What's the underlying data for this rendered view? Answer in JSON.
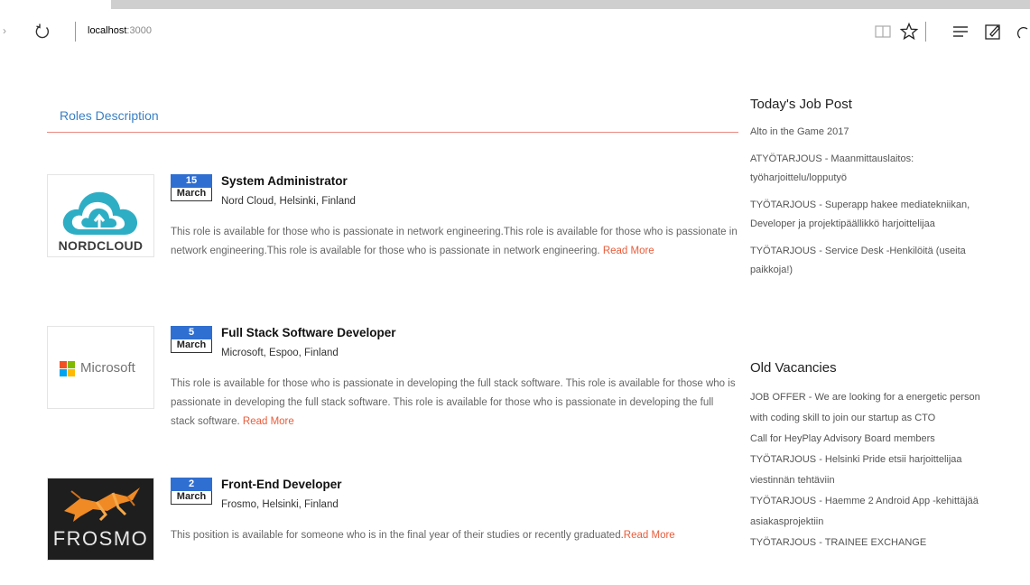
{
  "browser": {
    "url_host": "localhost",
    "url_port": ":3000"
  },
  "main": {
    "section_title": "Roles Description",
    "jobs": [
      {
        "day": "15",
        "month": "March",
        "title": "System Administrator",
        "company": "Nord Cloud, Helsinki, Finland",
        "description": "This role is available for those who is passionate in network engineering.This role is available for those who is passionate in network engineering.This role is available for those who is passionate in network engineering. ",
        "read_more": "Read More",
        "logo_text": "NORDCLOUD"
      },
      {
        "day": "5",
        "month": "March",
        "title": "Full Stack Software Developer",
        "company": "Microsoft, Espoo, Finland",
        "description": "This role is available for those who is passionate in developing the full stack software. This role is available for those who is passionate in developing the full stack software. This role is available for those who is passionate in developing the full stack software. ",
        "read_more": "Read More",
        "logo_text": "Microsoft"
      },
      {
        "day": "2",
        "month": "March",
        "title": "Front-End Developer",
        "company": "Frosmo, Helsinki, Finland",
        "description": "This position is available for someone who is in the final year of their studies or recently graduated.",
        "read_more": "Read More",
        "logo_text": "FROSMO"
      }
    ]
  },
  "sidebar": {
    "today_heading": "Today's Job Post",
    "today_items": [
      "Alto in the Game 2017",
      "ATYÖTARJOUS - Maanmittauslaitos: työharjoittelu/lopputyö",
      "TYÖTARJOUS - Superapp hakee mediatekniikan, Developer ja projektipäällikkö harjoittelijaa",
      "TYÖTARJOUS - Service Desk -Henkilöitä (useita paikkoja!)"
    ],
    "old_heading": "Old Vacancies",
    "old_items": [
      "JOB OFFER - We are looking for a energetic person with coding skill to join our startup as CTO",
      "Call for HeyPlay Advisory Board members",
      "TYÖTARJOUS - Helsinki Pride etsii harjoittelijaa viestinnän tehtäviin",
      "TYÖTARJOUS - Haemme 2 Android App -kehittäjää asiakasprojektiin",
      "TYÖTARJOUS - TRAINEE EXCHANGE"
    ]
  },
  "colors": {
    "accent_blue": "#3a7fc4",
    "badge_blue": "#2f6fd1",
    "read_more": "#e85c3a",
    "rule": "#e98a80"
  }
}
